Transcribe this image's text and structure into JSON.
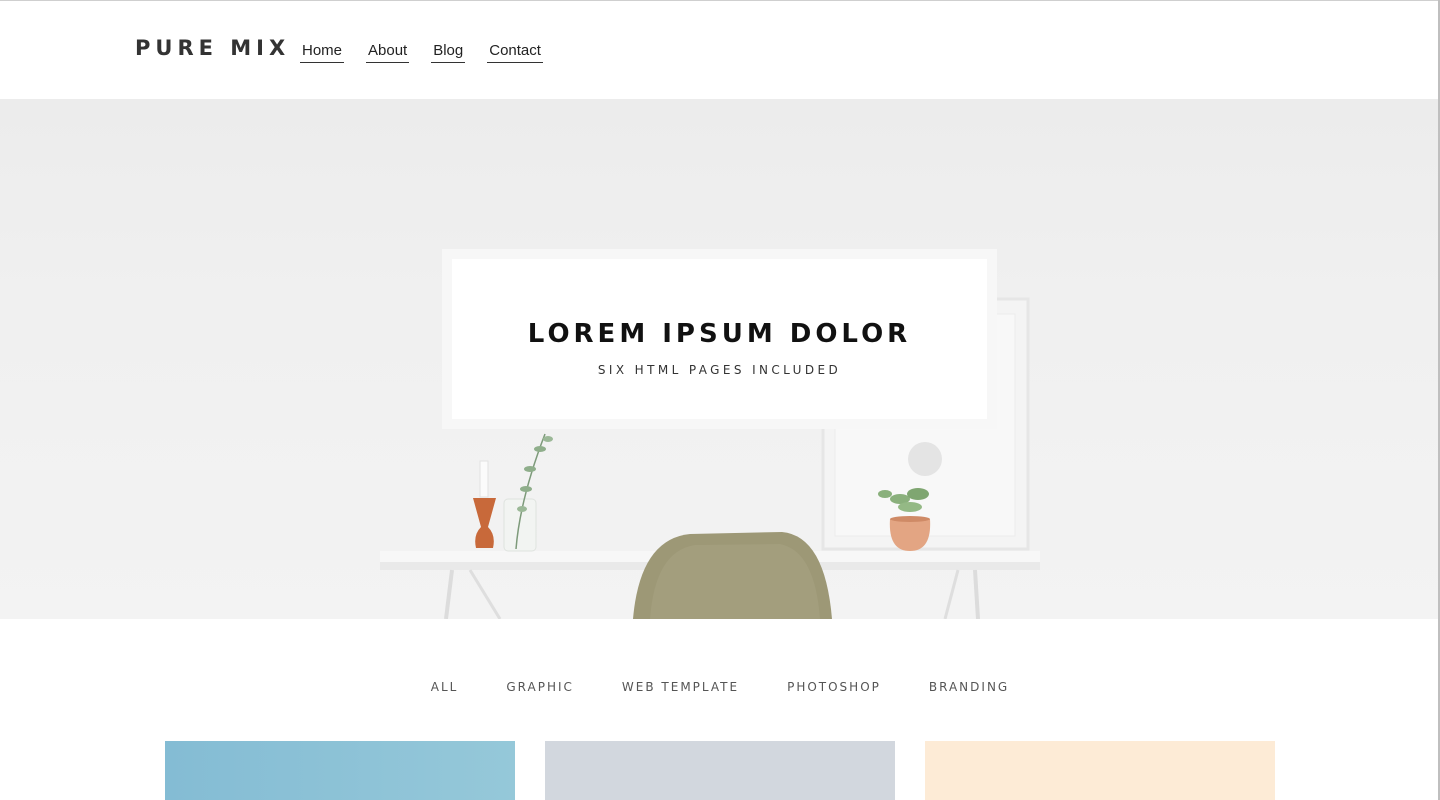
{
  "header": {
    "logo": "PURE MIX",
    "nav": [
      {
        "label": "Home"
      },
      {
        "label": "About"
      },
      {
        "label": "Blog"
      },
      {
        "label": "Contact"
      }
    ]
  },
  "hero": {
    "title": "LOREM IPSUM DOLOR",
    "subtitle": "SIX HTML PAGES INCLUDED",
    "image_description_icon": "desk-scene-illustration"
  },
  "filters": [
    {
      "label": "ALL"
    },
    {
      "label": "GRAPHIC"
    },
    {
      "label": "WEB TEMPLATE"
    },
    {
      "label": "PHOTOSHOP"
    },
    {
      "label": "BRANDING"
    }
  ],
  "colors": {
    "card_1": "#8cc2d6",
    "card_2": "#d2d7de",
    "card_3": "#fdebd6",
    "text": "#333333"
  }
}
